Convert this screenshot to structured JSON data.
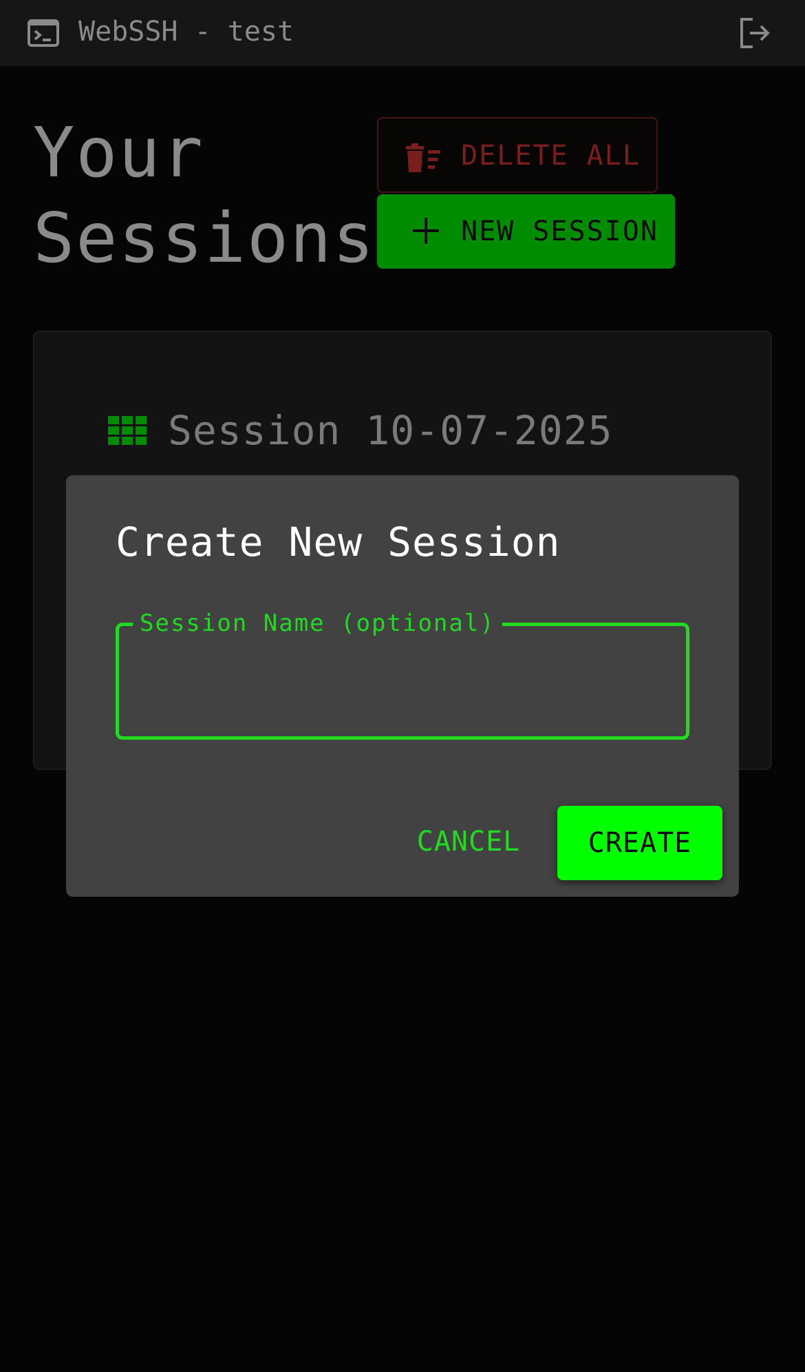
{
  "header": {
    "title": "WebSSH - test",
    "left_icon": "terminal-icon",
    "right_icon": "logout-icon"
  },
  "page": {
    "heading_line1": "Your",
    "heading_line2": "Sessions",
    "delete_all_label": "DELETE ALL",
    "new_session_label": "NEW SESSION"
  },
  "sessions": [
    {
      "name": "Session 10-07-2025",
      "icon": "grid-icon"
    }
  ],
  "dialog": {
    "title": "Create New Session",
    "field_label": "Session Name (optional)",
    "field_value": "",
    "cancel_label": "CANCEL",
    "create_label": "CREATE"
  },
  "colors": {
    "accent": "#00ff00",
    "danger": "#7a1d1d",
    "new_session_bg": "#008c00",
    "dialog_bg": "#424242"
  }
}
